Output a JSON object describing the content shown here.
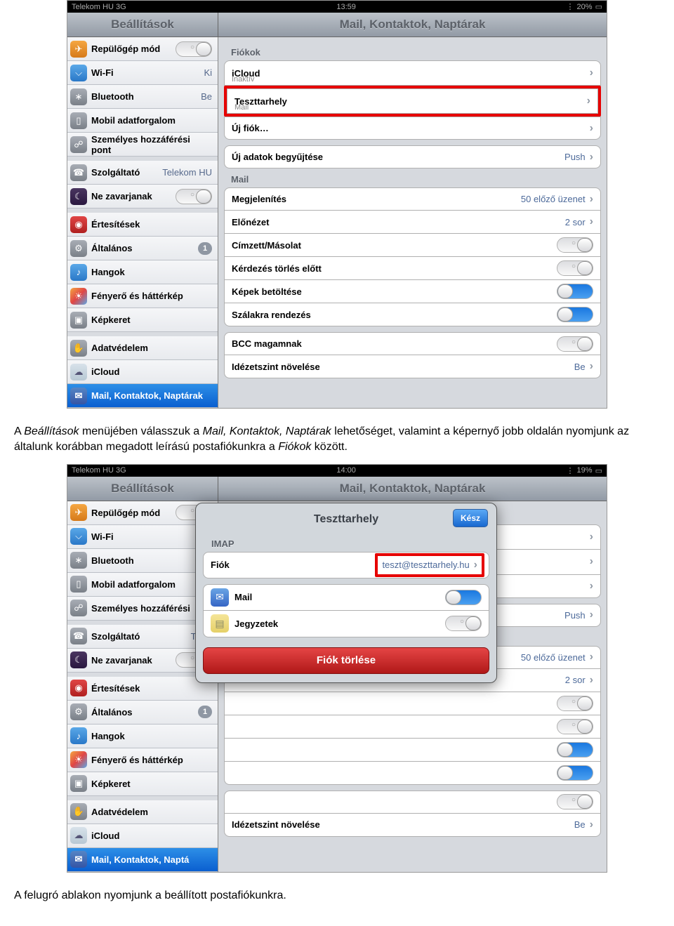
{
  "shot1": {
    "status": {
      "carrier": "Telekom HU  3G",
      "time": "13:59",
      "battery": "20%"
    },
    "header": {
      "left": "Beállítások",
      "right": "Mail, Kontaktok, Naptárak"
    },
    "sidebar": [
      {
        "icon": "✈",
        "cls": "orange",
        "label": "Repülőgép mód",
        "toggle": "off"
      },
      {
        "icon": "⌵",
        "cls": "blue",
        "label": "Wi-Fi",
        "value": "Ki"
      },
      {
        "icon": "∗",
        "cls": "grey",
        "label": "Bluetooth",
        "value": "Be"
      },
      {
        "icon": "▯",
        "cls": "grey",
        "label": "Mobil adatforgalom"
      },
      {
        "icon": "☍",
        "cls": "grey",
        "label": "Személyes hozzáférési pont"
      },
      {
        "icon": "☎",
        "cls": "grey",
        "label": "Szolgáltató",
        "value": "Telekom HU"
      },
      {
        "icon": "☾",
        "cls": "purple",
        "label": "Ne zavarjanak",
        "toggle": "off"
      },
      {
        "icon": "◉",
        "cls": "red",
        "label": "Értesítések"
      },
      {
        "icon": "⚙",
        "cls": "grey",
        "label": "Általános",
        "badge": "1"
      },
      {
        "icon": "♪",
        "cls": "blue",
        "label": "Hangok"
      },
      {
        "icon": "☀",
        "cls": "multi",
        "label": "Fényerő és háttérkép"
      },
      {
        "icon": "▣",
        "cls": "grey",
        "label": "Képkeret"
      },
      {
        "icon": "✋",
        "cls": "grey",
        "label": "Adatvédelem"
      },
      {
        "icon": "☁",
        "cls": "cloud",
        "label": "iCloud"
      },
      {
        "icon": "✉",
        "cls": "mail",
        "label": "Mail, Kontaktok, Naptárak",
        "selected": true
      }
    ],
    "detail": {
      "fiokokHdr": "Fiókok",
      "accounts": [
        {
          "title": "iCloud",
          "sub": "Inaktív"
        },
        {
          "title": "Teszttarhely",
          "sub": "Mail",
          "highlight": true
        }
      ],
      "newAccount": "Új fiók…",
      "fetch": {
        "label": "Új adatok begyűjtése",
        "value": "Push"
      },
      "mailHdr": "Mail",
      "mailItems": [
        {
          "label": "Megjelenítés",
          "value": "50 előző üzenet"
        },
        {
          "label": "Előnézet",
          "value": "2 sor"
        },
        {
          "label": "Címzett/Másolat",
          "toggle": "off"
        },
        {
          "label": "Kérdezés törlés előtt",
          "toggle": "off"
        },
        {
          "label": "Képek betöltése",
          "toggle": "on"
        },
        {
          "label": "Szálakra rendezés",
          "toggle": "on"
        }
      ],
      "bccItems": [
        {
          "label": "BCC magamnak",
          "toggle": "off"
        },
        {
          "label": "Idézetszint növelése",
          "value": "Be"
        }
      ]
    }
  },
  "para1": {
    "p1a": "A ",
    "p1b": "Beállítások",
    "p1c": " menüjében válasszuk a ",
    "p1d": "Mail, Kontaktok, Naptárak",
    "p1e": " lehetőséget, valamint a képernyő jobb oldalán nyomjunk az általunk korábban megadott leírású postafiókunkra a ",
    "p1f": "Fiókok",
    "p1g": " között."
  },
  "shot2": {
    "status": {
      "carrier": "Telekom HU  3G",
      "time": "14:00",
      "battery": "19%"
    },
    "popup": {
      "title": "Teszttarhely",
      "done": "Kész",
      "imapHdr": "IMAP",
      "account": {
        "label": "Fiók",
        "value": "teszt@teszttarhely.hu"
      },
      "svcs": [
        {
          "icon": "✉",
          "cls": "mail",
          "label": "Mail",
          "toggle": "on"
        },
        {
          "icon": "▤",
          "cls": "notes",
          "label": "Jegyzetek",
          "toggle": "off"
        }
      ],
      "delete": "Fiók törlése"
    },
    "detailValues": {
      "fetch": "Push",
      "show": "50 előző üzenet",
      "preview": "2 sor",
      "quote": "Be"
    }
  },
  "para2": "A felugró ablakon nyomjunk a beállított postafiókunkra."
}
